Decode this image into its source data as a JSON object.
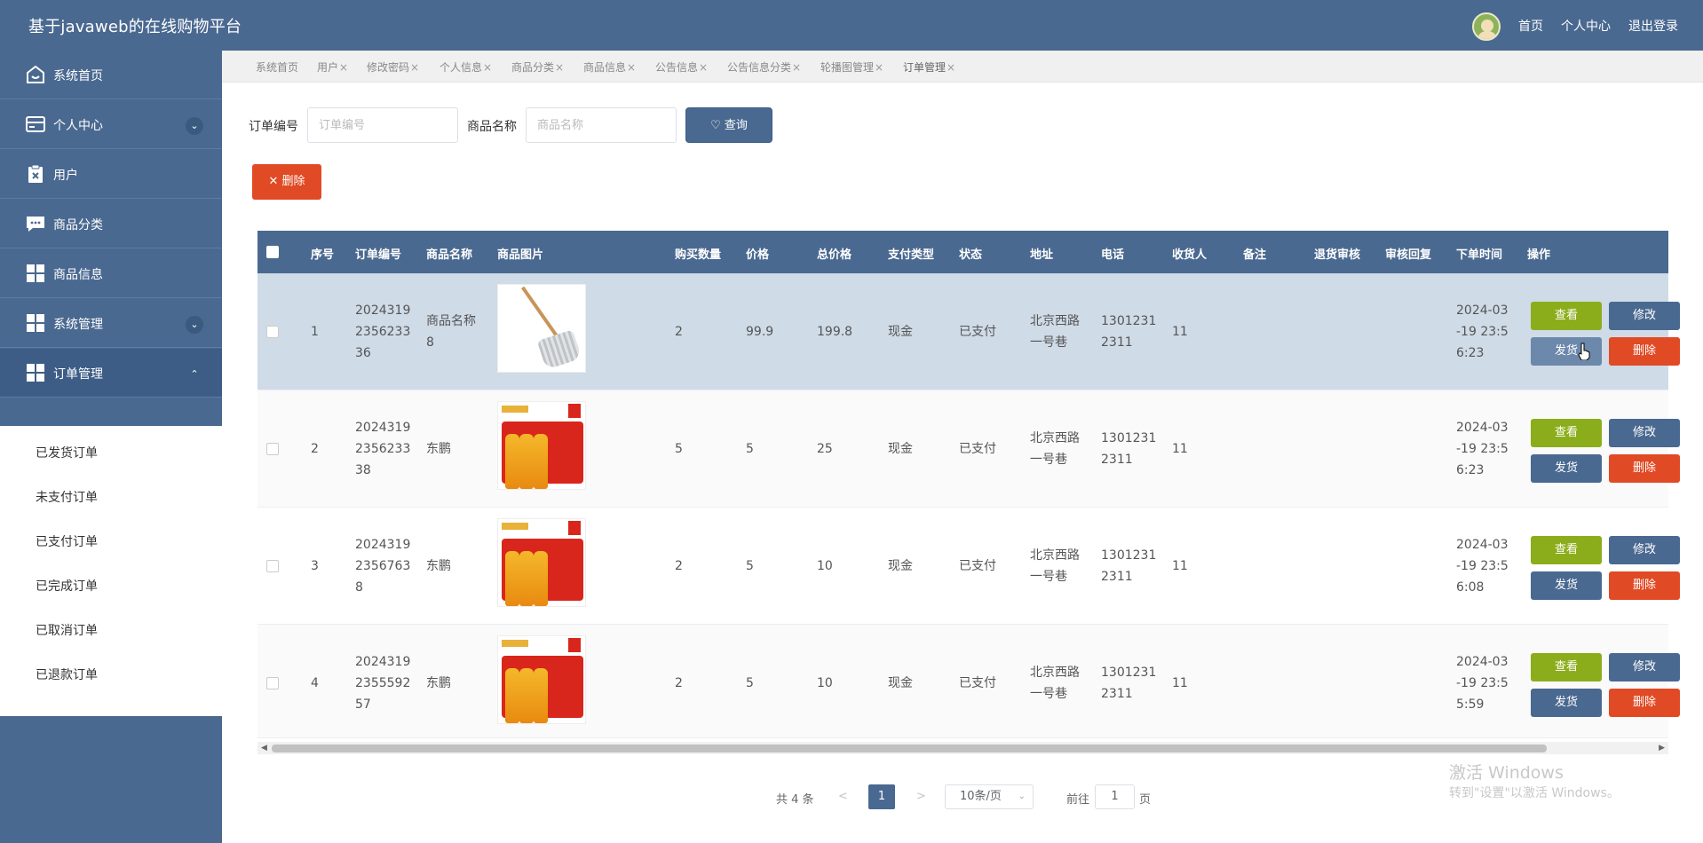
{
  "header": {
    "title": "基于javaweb的在线购物平台",
    "nav": [
      "首页",
      "个人中心",
      "退出登录"
    ]
  },
  "sidebar": {
    "items": [
      {
        "label": "系统首页",
        "icon": "home-icon"
      },
      {
        "label": "个人中心",
        "icon": "card-icon",
        "chevron": "⌄"
      },
      {
        "label": "用户",
        "icon": "clipboard-icon"
      },
      {
        "label": "商品分类",
        "icon": "chat-icon"
      },
      {
        "label": "商品信息",
        "icon": "grid-icon"
      },
      {
        "label": "系统管理",
        "icon": "grid-icon",
        "chevron": "⌄"
      },
      {
        "label": "订单管理",
        "icon": "grid-icon",
        "chevron": "⌃"
      }
    ],
    "subitems": [
      "已发货订单",
      "未支付订单",
      "已支付订单",
      "已完成订单",
      "已取消订单",
      "已退款订单"
    ]
  },
  "tabs": [
    {
      "label": "系统首页",
      "closable": false
    },
    {
      "label": "用户",
      "closable": true
    },
    {
      "label": "修改密码",
      "closable": true
    },
    {
      "label": "个人信息",
      "closable": true
    },
    {
      "label": "商品分类",
      "closable": true
    },
    {
      "label": "商品信息",
      "closable": true
    },
    {
      "label": "公告信息",
      "closable": true
    },
    {
      "label": "公告信息分类",
      "closable": true
    },
    {
      "label": "轮播图管理",
      "closable": true
    },
    {
      "label": "订单管理",
      "closable": true
    }
  ],
  "search": {
    "order_no_label": "订单编号",
    "order_no_placeholder": "订单编号",
    "product_name_label": "商品名称",
    "product_name_placeholder": "商品名称",
    "search_button": "查询",
    "delete_button": "删除"
  },
  "table": {
    "headers": [
      "序号",
      "订单编号",
      "商品名称",
      "商品图片",
      "购买数量",
      "价格",
      "总价格",
      "支付类型",
      "状态",
      "地址",
      "电话",
      "收货人",
      "备注",
      "退货审核",
      "审核回复",
      "下单时间",
      "操作"
    ],
    "rows": [
      {
        "index": "1",
        "order_no": [
          "2024319",
          "2356233",
          "36"
        ],
        "product": [
          "商品名称",
          "8"
        ],
        "image": "mop",
        "qty": "2",
        "price": "99.9",
        "total": "199.8",
        "pay_type": "现金",
        "status": "已支付",
        "address": [
          "北京西路",
          "一号巷"
        ],
        "phone": [
          "1301231",
          "2311"
        ],
        "receiver": "11",
        "time": [
          "2024-03",
          "-19 23:5",
          "6:23"
        ]
      },
      {
        "index": "2",
        "order_no": [
          "2024319",
          "2356233",
          "38"
        ],
        "product": [
          "东鹏"
        ],
        "image": "drink",
        "qty": "5",
        "price": "5",
        "total": "25",
        "pay_type": "现金",
        "status": "已支付",
        "address": [
          "北京西路",
          "一号巷"
        ],
        "phone": [
          "1301231",
          "2311"
        ],
        "receiver": "11",
        "time": [
          "2024-03",
          "-19 23:5",
          "6:23"
        ]
      },
      {
        "index": "3",
        "order_no": [
          "2024319",
          "2356763",
          "8"
        ],
        "product": [
          "东鹏"
        ],
        "image": "drink",
        "qty": "2",
        "price": "5",
        "total": "10",
        "pay_type": "现金",
        "status": "已支付",
        "address": [
          "北京西路",
          "一号巷"
        ],
        "phone": [
          "1301231",
          "2311"
        ],
        "receiver": "11",
        "time": [
          "2024-03",
          "-19 23:5",
          "6:08"
        ]
      },
      {
        "index": "4",
        "order_no": [
          "2024319",
          "2355592",
          "57"
        ],
        "product": [
          "东鹏"
        ],
        "image": "drink",
        "qty": "2",
        "price": "5",
        "total": "10",
        "pay_type": "现金",
        "status": "已支付",
        "address": [
          "北京西路",
          "一号巷"
        ],
        "phone": [
          "1301231",
          "2311"
        ],
        "receiver": "11",
        "time": [
          "2024-03",
          "-19 23:5",
          "5:59"
        ]
      }
    ],
    "actions": {
      "view": "查看",
      "edit": "修改",
      "ship": "发货",
      "delete": "删除"
    }
  },
  "pagination": {
    "total": "共 4 条",
    "prev": "<",
    "current": "1",
    "next": ">",
    "page_size": "10条/页",
    "goto_label": "前往",
    "goto_value": "1",
    "page_unit": "页"
  },
  "watermark": {
    "line1": "激活 Windows",
    "line2": "转到\"设置\"以激活 Windows。"
  },
  "colors": {
    "primary": "#4a6990",
    "danger": "#e04a24",
    "success": "#8cad1b"
  }
}
